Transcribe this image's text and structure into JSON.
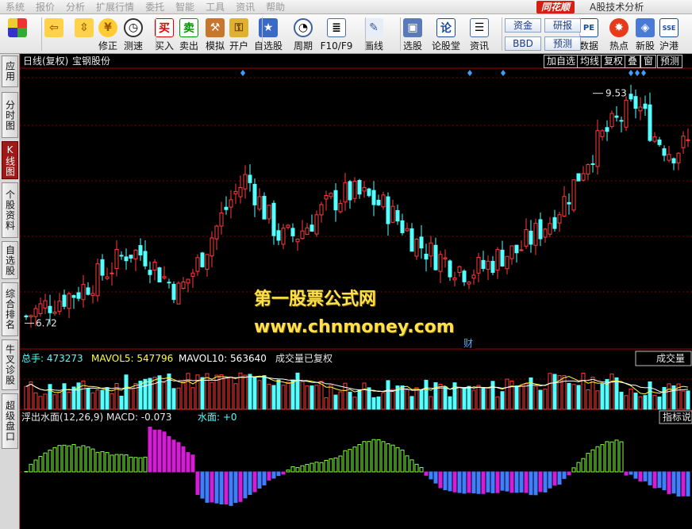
{
  "menubar": {
    "items": [
      "系统",
      "报价",
      "分析",
      "扩展行情",
      "委托",
      "智能",
      "工具",
      "资讯",
      "帮助"
    ],
    "brand": "同花顺",
    "app_title": "A股技术分析"
  },
  "toolbar": {
    "buttons": [
      {
        "label": "",
        "icon": "grid-icon"
      },
      {
        "label": "",
        "icon": "back-arrow-icon"
      },
      {
        "label": "",
        "icon": "up-down-arrow-icon"
      },
      {
        "label": "修正",
        "icon": "coin-icon"
      },
      {
        "label": "测速",
        "icon": "clock-icon"
      },
      {
        "label": "买入",
        "icon": "buy-icon",
        "glyph": "买"
      },
      {
        "label": "卖出",
        "icon": "sell-icon",
        "glyph": "卖"
      },
      {
        "label": "模拟",
        "icon": "hammer-icon"
      },
      {
        "label": "开户",
        "icon": "lock-icon"
      },
      {
        "label": "自选股",
        "icon": "star-icon"
      },
      {
        "label": "周期",
        "icon": "clock-cycle-icon"
      },
      {
        "label": "F10/F9",
        "icon": "document-icon"
      },
      {
        "label": "画线",
        "icon": "pencil-icon"
      },
      {
        "label": "选股",
        "icon": "monitor-icon"
      },
      {
        "label": "论股堂",
        "icon": "lun-icon",
        "glyph": "论"
      },
      {
        "label": "资讯",
        "icon": "news-icon"
      },
      {
        "label": "数据",
        "icon": "pe-icon",
        "glyph": "PE"
      },
      {
        "label": "热点",
        "icon": "hot-icon"
      },
      {
        "label": "新股",
        "icon": "new-stock-icon"
      },
      {
        "label": "沪港",
        "icon": "hk-icon"
      }
    ],
    "box_buttons": [
      "资金",
      "研报",
      "BBD",
      "预测"
    ]
  },
  "sidetabs": [
    {
      "label": "应用"
    },
    {
      "label": "分时图"
    },
    {
      "label": "K线图"
    },
    {
      "label": "个股资料"
    },
    {
      "label": "自选股"
    },
    {
      "label": "综合排名"
    },
    {
      "label": "牛叉诊股"
    },
    {
      "label": "超级盘口"
    }
  ],
  "kline": {
    "title": "日线(复权)",
    "stock_name": "宝钢股份",
    "buttons": [
      "加自选",
      "均线",
      "复权",
      "叠",
      "窗",
      "预测"
    ],
    "high_label": "9.53",
    "low_label": "6.72",
    "marker": "财"
  },
  "volume": {
    "total_label": "总手: 473273",
    "mavol5_label": "MAVOL5: 547796",
    "mavol10_label": "MAVOL10: 563640",
    "note": "成交量已复权",
    "panel_button": "成交量"
  },
  "macd": {
    "indicator_label": "浮出水面(12,26,9) MACD: -0.073",
    "water_label": "水面: +0",
    "panel_button": "指标说明"
  },
  "watermark": {
    "line1": "第一股票公式网",
    "line2": "www.chnmoney.com"
  },
  "colors": {
    "up": "#ff3b3b",
    "down": "#54ffff",
    "macd_up": "#d81bd8",
    "macd_green": "#7fff3f",
    "macd_down": "#3f7fff",
    "grid": "#7a0000",
    "background": "#000000",
    "watermark": "#ffe14a"
  },
  "chart_data": {
    "type": "candlestick",
    "series_close": [
      6.8,
      6.92,
      7.02,
      7.1,
      7.25,
      7.4,
      7.6,
      7.55,
      7.3,
      7.1,
      7.4,
      7.8,
      8.2,
      8.5,
      8.1,
      7.75,
      7.8,
      8.0,
      8.2,
      8.3,
      8.25,
      8.15,
      7.95,
      7.7,
      7.55,
      7.45,
      7.35,
      7.4,
      7.55,
      7.6,
      7.8,
      8.0,
      8.3,
      8.7,
      9.0,
      9.2,
      9.4,
      9.0,
      8.8,
      8.9
    ],
    "high": 9.53,
    "low": 6.72
  }
}
